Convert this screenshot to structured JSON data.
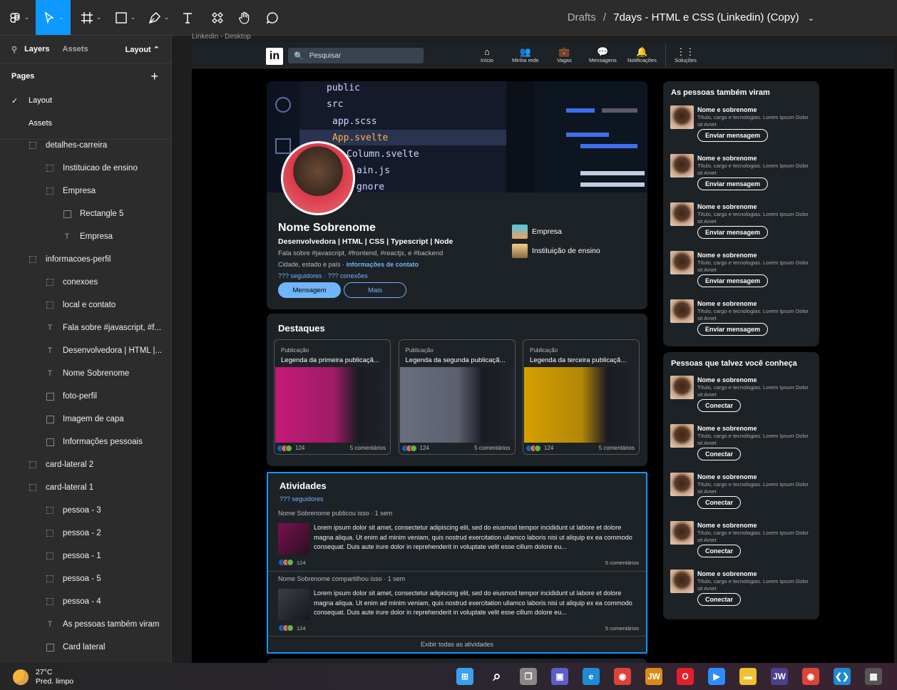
{
  "figma": {
    "doc_breadcrumb": "Drafts",
    "doc_separator": "/",
    "doc_title": "7days - HTML e CSS (Linkedin) (Copy)",
    "doc_chevron": "⌄",
    "tools": [
      "figma-menu",
      "move",
      "frame",
      "shape",
      "pen",
      "text",
      "components",
      "hand",
      "comment"
    ],
    "tab_layers": "Layers",
    "tab_assets": "Assets",
    "tab_layout": "Layout ⌃",
    "pages_header": "Pages",
    "add_page": "+",
    "pages": [
      {
        "label": "Layout",
        "active": true
      },
      {
        "label": "Assets",
        "active": false
      }
    ],
    "layers": [
      {
        "label": "detalhes-carreira",
        "indent": 1,
        "icon": "frame"
      },
      {
        "label": "Instituicao de ensino",
        "indent": 2,
        "icon": "frame"
      },
      {
        "label": "Empresa",
        "indent": 2,
        "icon": "frame"
      },
      {
        "label": "Rectangle 5",
        "indent": 3,
        "icon": "image"
      },
      {
        "label": "Empresa",
        "indent": 3,
        "icon": "text"
      },
      {
        "label": "informacoes-perfil",
        "indent": 1,
        "icon": "frame"
      },
      {
        "label": "conexoes",
        "indent": 2,
        "icon": "frame"
      },
      {
        "label": "local e contato",
        "indent": 2,
        "icon": "frame"
      },
      {
        "label": "Fala sobre #javascript, #f...",
        "indent": 2,
        "icon": "text"
      },
      {
        "label": "Desenvolvedora | HTML |...",
        "indent": 2,
        "icon": "text"
      },
      {
        "label": "Nome Sobrenome",
        "indent": 2,
        "icon": "text"
      },
      {
        "label": "foto-perfil",
        "indent": 2,
        "icon": "image"
      },
      {
        "label": "Imagem de capa",
        "indent": 2,
        "icon": "image"
      },
      {
        "label": "Informações pessoais",
        "indent": 2,
        "icon": "rect"
      },
      {
        "label": "card-lateral 2",
        "indent": 1,
        "icon": "frame"
      },
      {
        "label": "card-lateral 1",
        "indent": 1,
        "icon": "frame"
      },
      {
        "label": "pessoa - 3",
        "indent": 2,
        "icon": "frame"
      },
      {
        "label": "pessoa - 2",
        "indent": 2,
        "icon": "frame"
      },
      {
        "label": "pessoa - 1",
        "indent": 2,
        "icon": "frame"
      },
      {
        "label": "pessoa - 5",
        "indent": 2,
        "icon": "frame"
      },
      {
        "label": "pessoa - 4",
        "indent": 2,
        "icon": "frame"
      },
      {
        "label": "As pessoas também viram",
        "indent": 2,
        "icon": "text"
      },
      {
        "label": "Card lateral",
        "indent": 2,
        "icon": "rect"
      }
    ],
    "frame_label": "Linkedin - Desktop"
  },
  "linkedin": {
    "logo": "in",
    "search_placeholder": "Pesquisar",
    "nav": [
      {
        "label": "Início",
        "icon": "home-icon",
        "glyph": "⌂"
      },
      {
        "label": "Minha rede",
        "icon": "network-icon",
        "glyph": "👥"
      },
      {
        "label": "Vagas",
        "icon": "briefcase-icon",
        "glyph": "💼"
      },
      {
        "label": "Mensagens",
        "icon": "message-icon",
        "glyph": "💬"
      },
      {
        "label": "Notificações",
        "icon": "bell-icon",
        "glyph": "🔔"
      },
      {
        "label": "Soluções",
        "icon": "grid-icon",
        "glyph": "⋮⋮"
      }
    ],
    "cover_code": [
      "public",
      "src",
      "app.scss",
      "App.svelte",
      "Column.svelte",
      "ain.js",
      "gnore"
    ],
    "profile": {
      "name": "Nome Sobrenome",
      "headline": "Desenvolvedora | HTML | CSS | Typescript | Node",
      "about": "Fala sobre #javascript, #frontend, #reactjs, e #backend",
      "location": "Cidade, estado e país · ",
      "contact_link": "informações de contato",
      "followers": "??? seguidores · ??? conexões",
      "btn_message": "Mensagem",
      "btn_more": "Mais",
      "company": "Empresa",
      "school": "Instituição de ensino"
    },
    "highlights": {
      "title": "Destaques",
      "items": [
        {
          "kind": "Publicação",
          "caption": "Legenda da primeira publicaçã...",
          "reactions": "124",
          "comments": "5 comentários",
          "tint": "#c21a78"
        },
        {
          "kind": "Publicação",
          "caption": "Legenda da segunda publicaçã...",
          "reactions": "124",
          "comments": "5 comentários",
          "tint": "#6a6f80"
        },
        {
          "kind": "Publicação",
          "caption": "Legenda da terceira publicaçã...",
          "reactions": "124",
          "comments": "5 comentários",
          "tint": "#d6a000"
        }
      ]
    },
    "activities": {
      "title": "Atividades",
      "followers": "??? seguidores",
      "posts": [
        {
          "meta": "Nome Sobrenome publicou isso · 1 sem",
          "text": "Lorem ipsum dolor sit amet, consectetur adipiscing elit, sed do eiusmod tempor incididunt ut labore et dolore magna aliqua. Ut enim ad minim veniam, quis nostrud exercitation ullamco laboris nisi ut aliquip ex ea commodo consequat. Duis aute irure dolor in reprehenderit in voluptate velit esse cillum dolore eu...",
          "reactions": "124",
          "comments": "5 comentários"
        },
        {
          "meta": "Nome Sobrenome compartilhou isso · 1 sem",
          "text": "Lorem ipsum dolor sit amet, consectetur adipiscing elit, sed do eiusmod tempor incididunt ut labore et dolore magna aliqua. Ut enim ad minim veniam, quis nostrud exercitation ullamco laboris nisi ut aliquip ex ea commodo consequat. Duis aute irure dolor in reprehenderit in voluptate velit esse cillum dolore eu...",
          "reactions": "124",
          "comments": "5 comentários"
        }
      ],
      "show_all": "Exibir todas as atividades"
    },
    "sidebar1": {
      "title": "As pessoas também viram",
      "people": [
        {
          "name": "Nome e sobrenome",
          "desc": "Título, cargo e tecnologias. Lorem Ipsum Dolor sit Amet",
          "action": "Enviar mensagem"
        },
        {
          "name": "Nome e sobrenome",
          "desc": "Título, cargo e tecnologias. Lorem Ipsum Dolor sit Amet",
          "action": "Enviar mensagem"
        },
        {
          "name": "Nome e sobrenome",
          "desc": "Título, cargo e tecnologias. Lorem Ipsum Dolor sit Amet",
          "action": "Enviar mensagem"
        },
        {
          "name": "Nome e sobrenome",
          "desc": "Título, cargo e tecnologias. Lorem Ipsum Dolor sit Amet",
          "action": "Enviar mensagem"
        },
        {
          "name": "Nome e sobrenome",
          "desc": "Título, cargo e tecnologias. Lorem Ipsum Dolor sit Amet",
          "action": "Enviar mensagem"
        }
      ]
    },
    "sidebar2": {
      "title": "Pessoas que talvez você conheça",
      "people": [
        {
          "name": "Nome e sobrenome",
          "desc": "Título, cargo e tecnologias. Lorem Ipsum Dolor sit Amet",
          "action": "Conectar"
        },
        {
          "name": "Nome e sobrenome",
          "desc": "Título, cargo e tecnologias. Lorem Ipsum Dolor sit Amet",
          "action": "Conectar"
        },
        {
          "name": "Nome e sobrenome",
          "desc": "Título, cargo e tecnologias. Lorem Ipsum Dolor sit Amet",
          "action": "Conectar"
        },
        {
          "name": "Nome e sobrenome",
          "desc": "Título, cargo e tecnologias. Lorem Ipsum Dolor sit Amet",
          "action": "Conectar"
        },
        {
          "name": "Nome e sobrenome",
          "desc": "Título, cargo e tecnologias. Lorem Ipsum Dolor sit Amet",
          "action": "Conectar"
        }
      ]
    }
  },
  "taskbar": {
    "temp": "27°C",
    "weather": "Pred. limpo",
    "apps": [
      {
        "name": "windows-start-icon",
        "color": "#3aa0f0",
        "glyph": "⊞"
      },
      {
        "name": "search-icon",
        "color": "transparent",
        "glyph": "⌕"
      },
      {
        "name": "task-view-icon",
        "color": "#888",
        "glyph": "❐"
      },
      {
        "name": "teams-icon",
        "color": "#5b5fc7",
        "glyph": "▣"
      },
      {
        "name": "edge-icon",
        "color": "#1e8bd6",
        "glyph": "e"
      },
      {
        "name": "chrome-icon",
        "color": "#db4437",
        "glyph": "◉"
      },
      {
        "name": "jw-icon",
        "color": "#d98b18",
        "glyph": "JW"
      },
      {
        "name": "opera-icon",
        "color": "#e0202a",
        "glyph": "O"
      },
      {
        "name": "zoom-icon",
        "color": "#2d8cff",
        "glyph": "▶"
      },
      {
        "name": "file-explorer-icon",
        "color": "#f0c030",
        "glyph": "▬"
      },
      {
        "name": "jw-library-icon",
        "color": "#4b3f8f",
        "glyph": "JW"
      },
      {
        "name": "chrome-active-icon",
        "color": "#db4437",
        "glyph": "◉"
      },
      {
        "name": "vscode-icon",
        "color": "#1f8ad2",
        "glyph": "❮❯"
      },
      {
        "name": "calculator-icon",
        "color": "#555",
        "glyph": "▦"
      }
    ]
  }
}
